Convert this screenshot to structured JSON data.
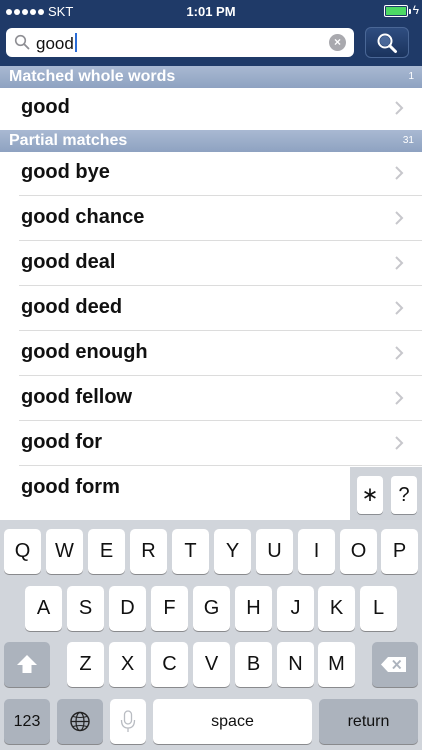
{
  "status": {
    "carrier": "SKT",
    "time": "1:01 PM",
    "battery_level": 1.0,
    "bolt": "ϟ"
  },
  "search": {
    "query": "good",
    "clear_glyph": "×"
  },
  "sections": [
    {
      "title": "Matched whole words",
      "count": "1",
      "items": [
        "good"
      ]
    },
    {
      "title": "Partial matches",
      "count": "31",
      "items": [
        "good bye",
        "good chance",
        "good deal",
        "good deed",
        "good enough",
        "good fellow",
        "good for",
        "good form"
      ]
    }
  ],
  "accessory_keys": [
    "∗",
    "?"
  ],
  "keyboard": {
    "row1": [
      "Q",
      "W",
      "E",
      "R",
      "T",
      "Y",
      "U",
      "I",
      "O",
      "P"
    ],
    "row2": [
      "A",
      "S",
      "D",
      "F",
      "G",
      "H",
      "J",
      "K",
      "L"
    ],
    "row3": [
      "Z",
      "X",
      "C",
      "V",
      "B",
      "N",
      "M"
    ],
    "numbers_label": "123",
    "space_label": "space",
    "return_label": "return"
  },
  "icons": {
    "search": "magnifier-icon",
    "chevron": "chevron-right-icon",
    "shift": "shift-icon",
    "delete": "delete-icon",
    "globe": "globe-icon",
    "mic": "microphone-icon"
  }
}
